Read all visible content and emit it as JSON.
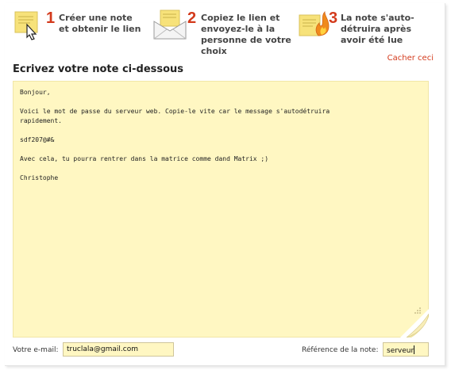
{
  "steps": [
    {
      "number": "1",
      "text": "Créer une note et obtenir le lien",
      "icon": "note-cursor-icon"
    },
    {
      "number": "2",
      "text": "Copiez le lien et envoyez-le à la personne de votre choix",
      "icon": "envelope-note-icon"
    },
    {
      "number": "3",
      "text": "La note s'auto-détruira après avoir été lue",
      "icon": "burning-note-icon"
    }
  ],
  "hide_link": "Cacher ceci",
  "title": "Ecrivez votre note ci-dessous",
  "note": {
    "content": "Bonjour,\n\nVoici le mot de passe du serveur web. Copie-le vite car le message s'autodétruira\nrapidement.\n\nsdf207@#&\n\nAvec cela, tu pourra rentrer dans la matrice comme dand Matrix ;)\n\nChristophe"
  },
  "footer": {
    "email_label": "Votre e-mail:",
    "email_value": "truclala@gmail.com",
    "reference_label": "Référence de la note:",
    "reference_value": "serveur"
  },
  "colors": {
    "accent": "#d33a1c",
    "note_bg": "#fff7c2",
    "icon_yellow": "#f7e27a"
  }
}
